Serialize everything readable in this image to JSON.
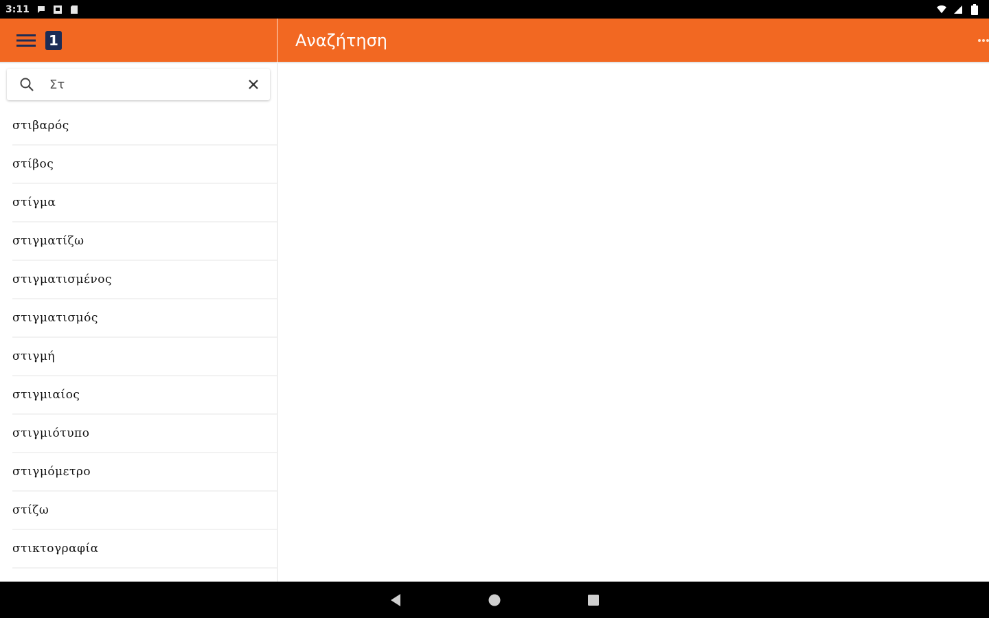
{
  "status_bar": {
    "time": "3:11",
    "left_icons": [
      "chat-bubble-icon",
      "notification-square-icon",
      "sd-card-icon"
    ],
    "right_icons": [
      "wifi-icon",
      "signal-icon",
      "battery-icon"
    ]
  },
  "app_bar": {
    "menu_icon": "hamburger-menu-icon",
    "logo_text": "1",
    "title": "Αναζήτηση",
    "overflow_icon": "more-options-icon",
    "colors": {
      "primary": "#f26822",
      "logo_bg": "#1c2c55"
    }
  },
  "search": {
    "value": "Στ",
    "search_icon": "search-icon",
    "clear_icon": "close-icon"
  },
  "results": [
    "στιβαρός",
    "στίβος",
    "στίγμα",
    "στιγματίζω",
    "στιγματισμένος",
    "στιγματισμός",
    "στιγμή",
    "στιγμιαίος",
    "στιγμιότυπο",
    "στιγμόμετρο",
    "στίζω",
    "στικτογραφία"
  ],
  "nav_bar": {
    "buttons": [
      "back-icon",
      "home-icon",
      "recents-icon"
    ]
  }
}
